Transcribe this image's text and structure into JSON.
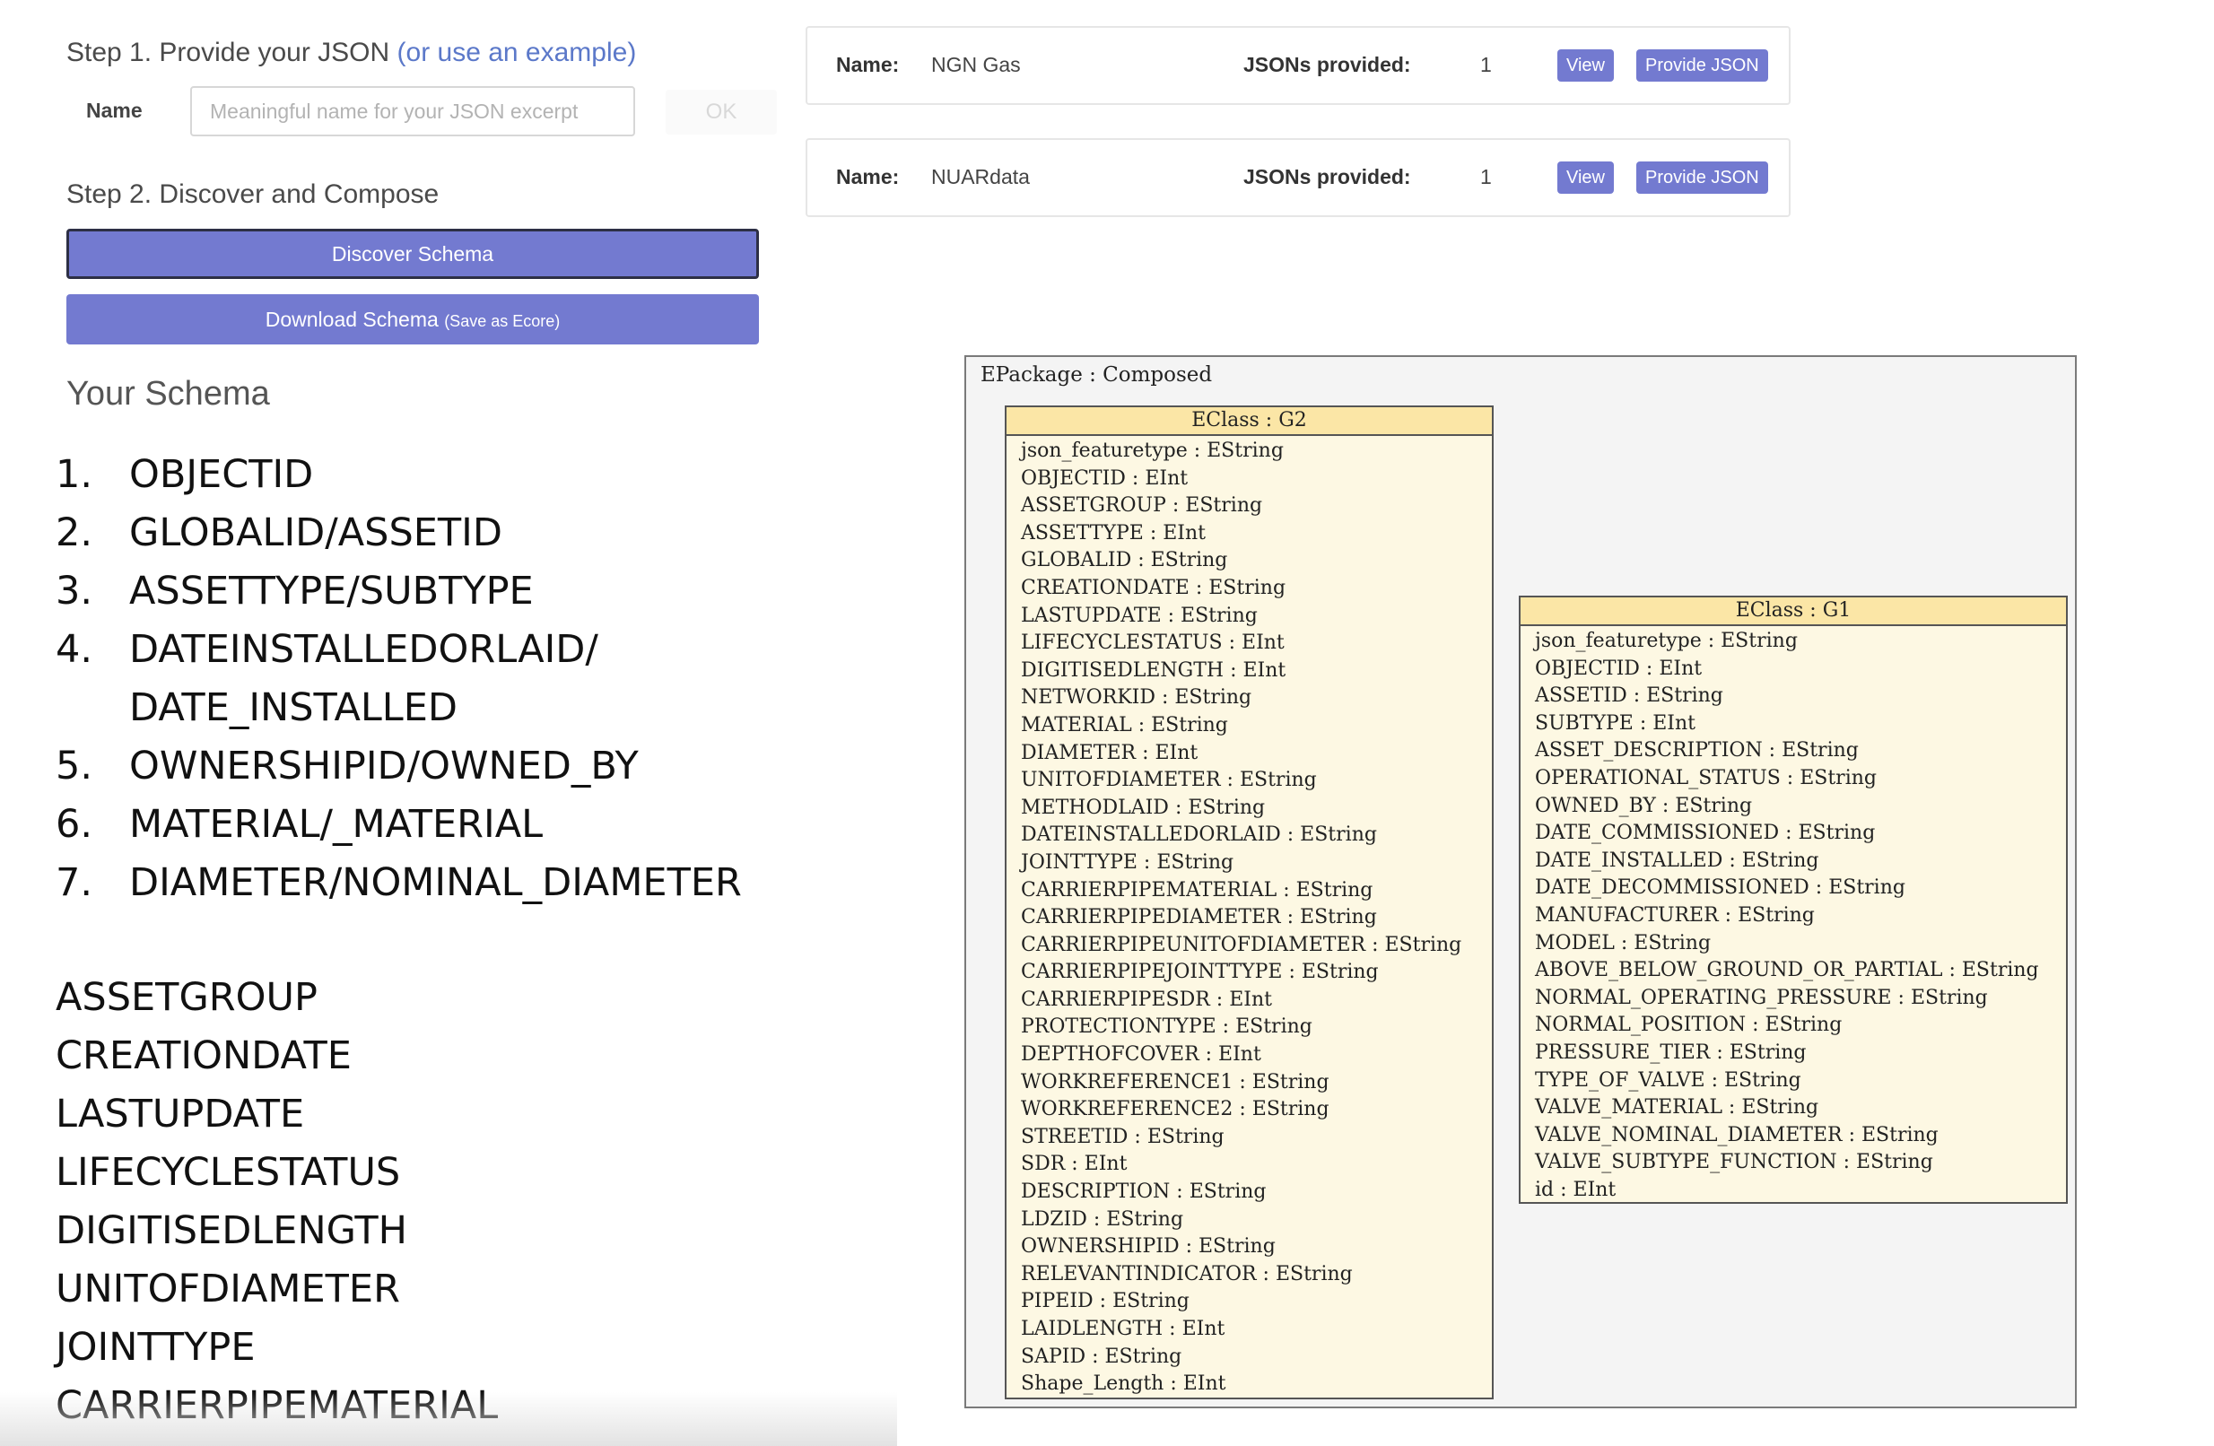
{
  "step1": {
    "title": "Step 1. Provide your JSON",
    "example_link": "(or use an example)",
    "name_label": "Name",
    "name_placeholder": "Meaningful name for your JSON excerpt",
    "ok_label": "OK"
  },
  "step2": {
    "title": "Step 2. Discover and Compose",
    "discover_label": "Discover Schema",
    "download_label": "Download Schema",
    "download_hint": "(Save as Ecore)"
  },
  "schema": {
    "heading": "Your Schema",
    "numbered": [
      {
        "num": "1.",
        "lines": [
          "OBJECTID"
        ]
      },
      {
        "num": "2.",
        "lines": [
          "GLOBALID/ASSETID"
        ]
      },
      {
        "num": "3.",
        "lines": [
          "ASSETTYPE/SUBTYPE"
        ]
      },
      {
        "num": "4.",
        "lines": [
          "DATEINSTALLEDORLAID/",
          "DATE_INSTALLED"
        ]
      },
      {
        "num": "5.",
        "lines": [
          "OWNERSHIPID/OWNED_BY"
        ]
      },
      {
        "num": "6.",
        "lines": [
          "MATERIAL/_MATERIAL"
        ]
      },
      {
        "num": "7.",
        "lines": [
          "DIAMETER/NOMINAL_DIAMETER"
        ]
      }
    ],
    "plain": [
      "ASSETGROUP",
      "CREATIONDATE",
      "LASTUPDATE",
      "LIFECYCLESTATUS",
      "DIGITISEDLENGTH",
      "UNITOFDIAMETER",
      "JOINTTYPE",
      "CARRIERPIPEMATERIAL"
    ]
  },
  "datasets": [
    {
      "name_label": "Name:",
      "name": "NGN Gas",
      "jsons_label": "JSONs provided:",
      "count": "1",
      "view_label": "View",
      "provide_label": "Provide JSON"
    },
    {
      "name_label": "Name:",
      "name": "NUARdata",
      "jsons_label": "JSONs provided:",
      "count": "1",
      "view_label": "View",
      "provide_label": "Provide JSON"
    }
  ],
  "diagram": {
    "package_title": "EPackage : Composed",
    "g2": {
      "title": "EClass : G2",
      "attributes": [
        "json_featuretype : EString",
        "OBJECTID : EInt",
        "ASSETGROUP : EString",
        "ASSETTYPE : EInt",
        "GLOBALID : EString",
        "CREATIONDATE : EString",
        "LASTUPDATE : EString",
        "LIFECYCLESTATUS : EInt",
        "DIGITISEDLENGTH : EInt",
        "NETWORKID : EString",
        "MATERIAL : EString",
        "DIAMETER : EInt",
        "UNITOFDIAMETER : EString",
        "METHODLAID : EString",
        "DATEINSTALLEDORLAID : EString",
        "JOINTTYPE : EString",
        "CARRIERPIPEMATERIAL : EString",
        "CARRIERPIPEDIAMETER : EString",
        "CARRIERPIPEUNITOFDIAMETER : EString",
        "CARRIERPIPEJOINTTYPE : EString",
        "CARRIERPIPESDR : EInt",
        "PROTECTIONTYPE : EString",
        "DEPTHOFCOVER : EInt",
        "WORKREFERENCE1 : EString",
        "WORKREFERENCE2 : EString",
        "STREETID : EString",
        "SDR : EInt",
        "DESCRIPTION : EString",
        "LDZID : EString",
        "OWNERSHIPID : EString",
        "RELEVANTINDICATOR : EString",
        "PIPEID : EString",
        "LAIDLENGTH : EInt",
        "SAPID : EString",
        "Shape_Length : EInt"
      ]
    },
    "g1": {
      "title": "EClass : G1",
      "attributes": [
        "json_featuretype : EString",
        "OBJECTID : EInt",
        "ASSETID : EString",
        "SUBTYPE : EInt",
        "ASSET_DESCRIPTION : EString",
        "OPERATIONAL_STATUS : EString",
        "OWNED_BY : EString",
        "DATE_COMMISSIONED : EString",
        "DATE_INSTALLED : EString",
        "DATE_DECOMMISSIONED : EString",
        "MANUFACTURER : EString",
        "MODEL : EString",
        "ABOVE_BELOW_GROUND_OR_PARTIAL : EString",
        "NORMAL_OPERATING_PRESSURE : EString",
        "NORMAL_POSITION : EString",
        "PRESSURE_TIER : EString",
        "TYPE_OF_VALVE : EString",
        "VALVE_MATERIAL : EString",
        "VALVE_NOMINAL_DIAMETER : EString",
        "VALVE_SUBTYPE_FUNCTION : EString",
        "id : EInt"
      ]
    }
  }
}
